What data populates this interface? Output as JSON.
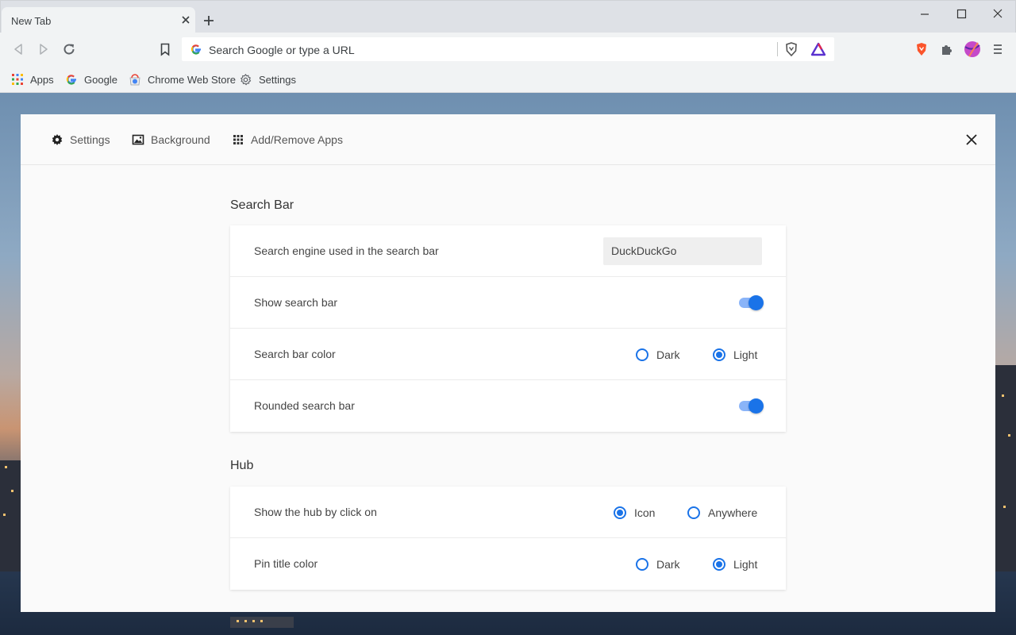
{
  "browser": {
    "tab_title": "New Tab",
    "omnibox_placeholder": "Search Google or type a URL",
    "bookmarks": [
      {
        "label": "Apps",
        "icon": "apps-grid-icon"
      },
      {
        "label": "Google",
        "icon": "google-g-icon"
      },
      {
        "label": "Chrome Web Store",
        "icon": "chrome-web-store-icon"
      },
      {
        "label": "Settings",
        "icon": "gear-icon"
      }
    ]
  },
  "panel": {
    "tabs": [
      {
        "label": "Settings",
        "icon": "gear-icon"
      },
      {
        "label": "Background",
        "icon": "image-icon"
      },
      {
        "label": "Add/Remove Apps",
        "icon": "apps-grid-icon"
      }
    ],
    "sections": [
      {
        "title": "Search Bar",
        "rows": [
          {
            "label": "Search engine used in the search bar",
            "control": "select",
            "value": "DuckDuckGo"
          },
          {
            "label": "Show search bar",
            "control": "toggle",
            "on": true
          },
          {
            "label": "Search bar color",
            "control": "radio",
            "options": [
              "Dark",
              "Light"
            ],
            "selected": "Light"
          },
          {
            "label": "Rounded search bar",
            "control": "toggle",
            "on": true
          }
        ]
      },
      {
        "title": "Hub",
        "rows": [
          {
            "label": "Show the hub by click on",
            "control": "radio",
            "options": [
              "Icon",
              "Anywhere"
            ],
            "selected": "Icon"
          },
          {
            "label": "Pin title color",
            "control": "radio",
            "options": [
              "Dark",
              "Light"
            ],
            "selected": "Light"
          }
        ]
      }
    ]
  },
  "colors": {
    "accent": "#1a73e8",
    "toggle_track": "#8ab4f8",
    "brave_orange": "#fb542b"
  }
}
